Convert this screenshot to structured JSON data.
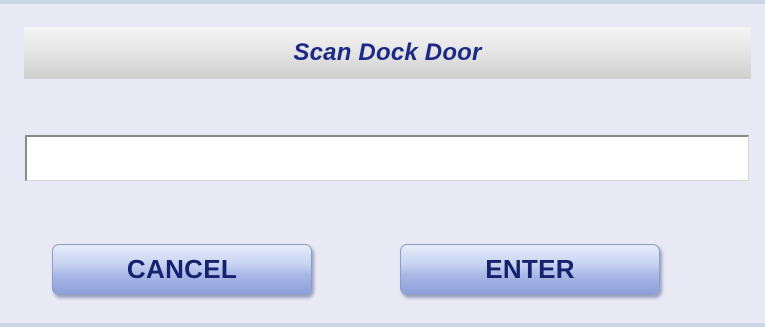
{
  "dialog": {
    "title": "Scan Dock Door"
  },
  "scan_field": {
    "value": "",
    "placeholder": ""
  },
  "buttons": {
    "cancel_label": "CANCEL",
    "enter_label": "ENTER"
  },
  "colors": {
    "background": "#e9e9f6",
    "title_text": "#1c2a86",
    "button_text": "#16226e",
    "button_fill": "#a8b8e6"
  }
}
